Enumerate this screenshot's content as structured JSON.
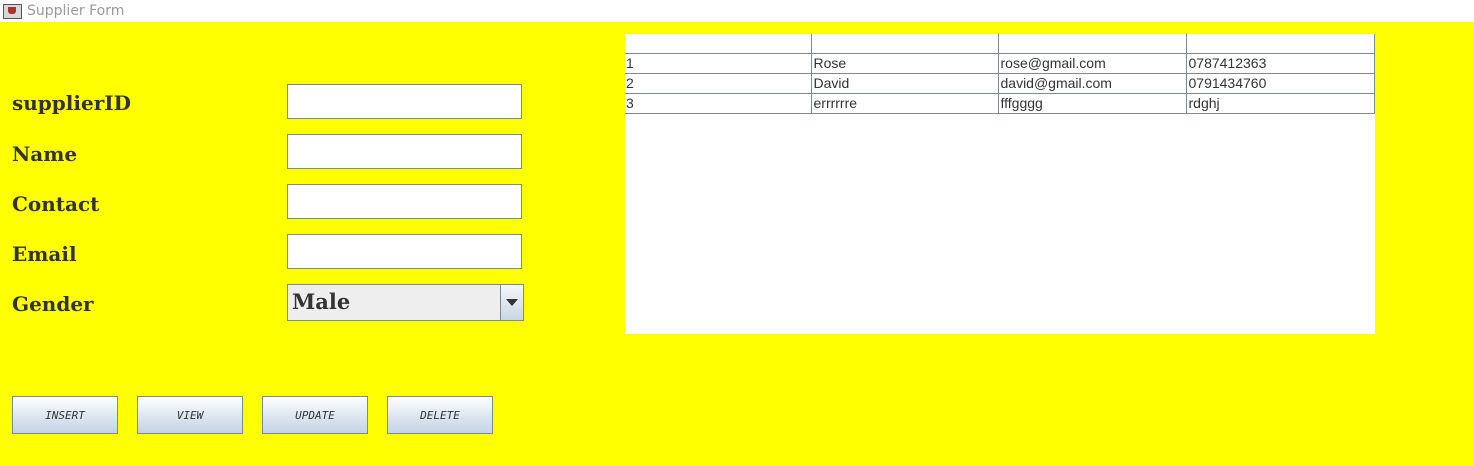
{
  "window": {
    "title": "Supplier Form",
    "icon": "java-cup-icon"
  },
  "form": {
    "fields": [
      {
        "label": "supplierID",
        "value": ""
      },
      {
        "label": "Name",
        "value": ""
      },
      {
        "label": "Contact",
        "value": ""
      },
      {
        "label": "Email",
        "value": ""
      }
    ],
    "gender": {
      "label": "Gender",
      "selected": "Male"
    }
  },
  "buttons": {
    "insert": "INSERT",
    "view": "VIEW",
    "update": "UPDATE",
    "delete": "DELETE"
  },
  "table": {
    "columns": [
      "",
      "",
      "",
      ""
    ],
    "rows": [
      [
        "1",
        "Rose",
        "rose@gmail.com",
        "0787412363"
      ],
      [
        "2",
        "David",
        "david@gmail.com",
        "0791434760"
      ],
      [
        "3",
        "errrrrre",
        "fffgggg",
        "rdghj"
      ]
    ]
  },
  "colors": {
    "background": "#ffff00",
    "border": "#7a8a99"
  }
}
